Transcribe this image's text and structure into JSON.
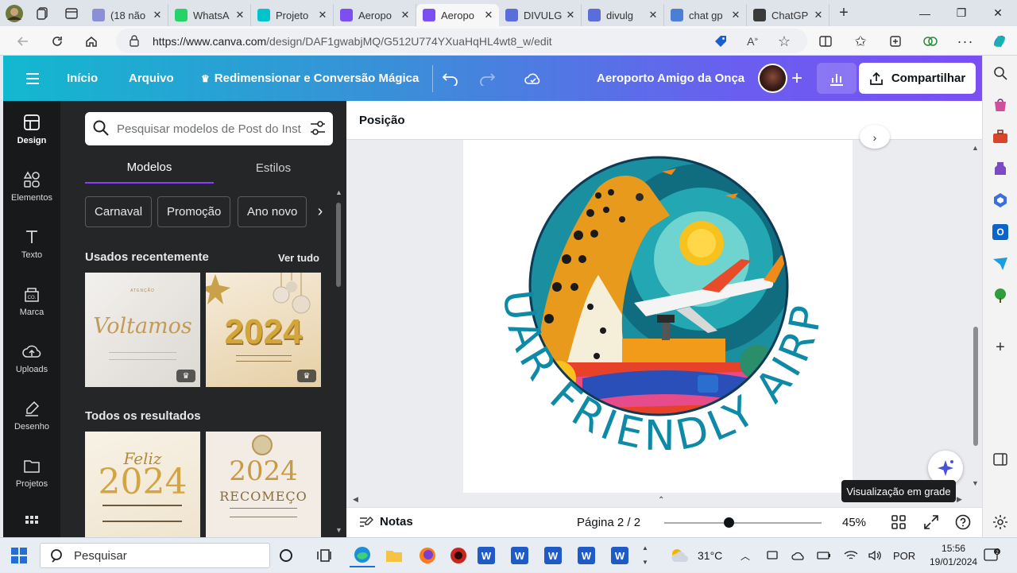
{
  "browser": {
    "tabs": [
      {
        "title": "(18 não",
        "favicon": "mail-icon",
        "color": "#8a8fd6",
        "active": false
      },
      {
        "title": "WhatsA",
        "favicon": "whatsapp-icon",
        "color": "#25d366",
        "active": false
      },
      {
        "title": "Projeto",
        "favicon": "canva-icon",
        "color": "#00c4cc",
        "active": false
      },
      {
        "title": "Aeropo",
        "favicon": "canva-icon",
        "color": "#7b4ff2",
        "active": false
      },
      {
        "title": "Aeropo",
        "favicon": "canva-icon",
        "color": "#7b4ff2",
        "active": true
      },
      {
        "title": "DIVULG",
        "favicon": "forms-icon",
        "color": "#5b6cdb",
        "active": false
      },
      {
        "title": "divulg",
        "favicon": "forms-icon",
        "color": "#5b6cdb",
        "active": false
      },
      {
        "title": "chat gp",
        "favicon": "search-icon",
        "color": "#4b7fd6",
        "active": false
      },
      {
        "title": "ChatGP",
        "favicon": "chatgpt-icon",
        "color": "#3a3a3a",
        "active": false
      }
    ],
    "url_host": "https://www.canva.com",
    "url_path": "/design/DAF1gwabjMQ/G512U774YXuaHqHL4wt8_w/edit"
  },
  "canva": {
    "menu_home": "Início",
    "menu_file": "Arquivo",
    "menu_resize": "Redimensionar e Conversão Mágica",
    "design_title": "Aeroporto Amigo da Onça",
    "share_label": "Compartilhar",
    "rail": [
      {
        "label": "Design",
        "icon": "design-icon"
      },
      {
        "label": "Elementos",
        "icon": "elements-icon"
      },
      {
        "label": "Texto",
        "icon": "text-icon"
      },
      {
        "label": "Marca",
        "icon": "brand-icon"
      },
      {
        "label": "Uploads",
        "icon": "upload-icon"
      },
      {
        "label": "Desenho",
        "icon": "draw-icon"
      },
      {
        "label": "Projetos",
        "icon": "folder-icon"
      }
    ],
    "panel": {
      "search_placeholder": "Pesquisar modelos de Post do Inst",
      "tab_models": "Modelos",
      "tab_styles": "Estilos",
      "chips": [
        "Carnaval",
        "Promoção",
        "Ano novo"
      ],
      "recent_title": "Usados recentemente",
      "see_all": "Ver tudo",
      "all_results_title": "Todos os resultados",
      "thumbs": {
        "t1_small": "ATENÇÃO",
        "t1_main": "Voltamos",
        "t2_main": "2024",
        "t3_top": "Feliz",
        "t3_main": "2024",
        "t4_main": "2024",
        "t4_sub": "RECOMEÇO"
      }
    },
    "context_label": "Posição",
    "artwork": {
      "arc_text": "JAGUAR FRIENDLY AIRPORT"
    },
    "notes_label": "Notas",
    "page_indicator": "Página 2 / 2",
    "zoom": "45%",
    "zoom_value": 0.45,
    "tooltip": "Visualização em grade"
  },
  "taskbar": {
    "search_placeholder": "Pesquisar",
    "temperature": "31°C",
    "language": "POR",
    "time": "15:56",
    "date": "19/01/2024"
  }
}
